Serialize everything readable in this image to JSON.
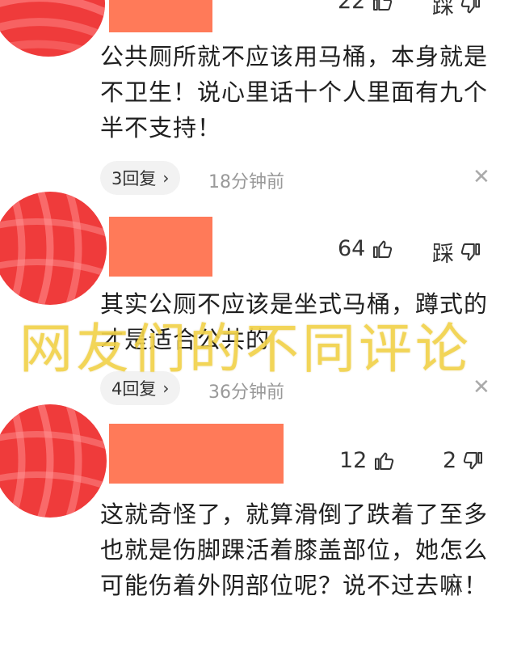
{
  "comments": [
    {
      "like_count": "22",
      "dislike_label": "踩",
      "text": "公共厕所就不应该用马桶，本身就是不卫生！说心里话十个人里面有九个半不支持！",
      "reply_label": "3回复",
      "time": "18分钟前"
    },
    {
      "like_count": "64",
      "dislike_label": "踩",
      "text": "其实公厕不应该是坐式马桶，蹲式的才是适合公共的",
      "reply_label": "4回复",
      "time": "36分钟前"
    },
    {
      "like_count": "12",
      "dislike_label": "2",
      "text": "这就奇怪了，就算滑倒了跌着了至多也就是伤脚踝活着膝盖部位，她怎么可能伤着外阴部位呢？说不过去嘛！"
    }
  ],
  "overlay": {
    "watermark_text": "网友们的不同评论"
  },
  "icons": {
    "like": "thumbs-up-icon",
    "dislike": "thumbs-down-icon",
    "chevron": "chevron-right-icon",
    "close": "close-icon"
  },
  "colors": {
    "avatar_red": "#ef3b3b",
    "name_block": "#ff7a59",
    "watermark": "#f1d24a"
  }
}
